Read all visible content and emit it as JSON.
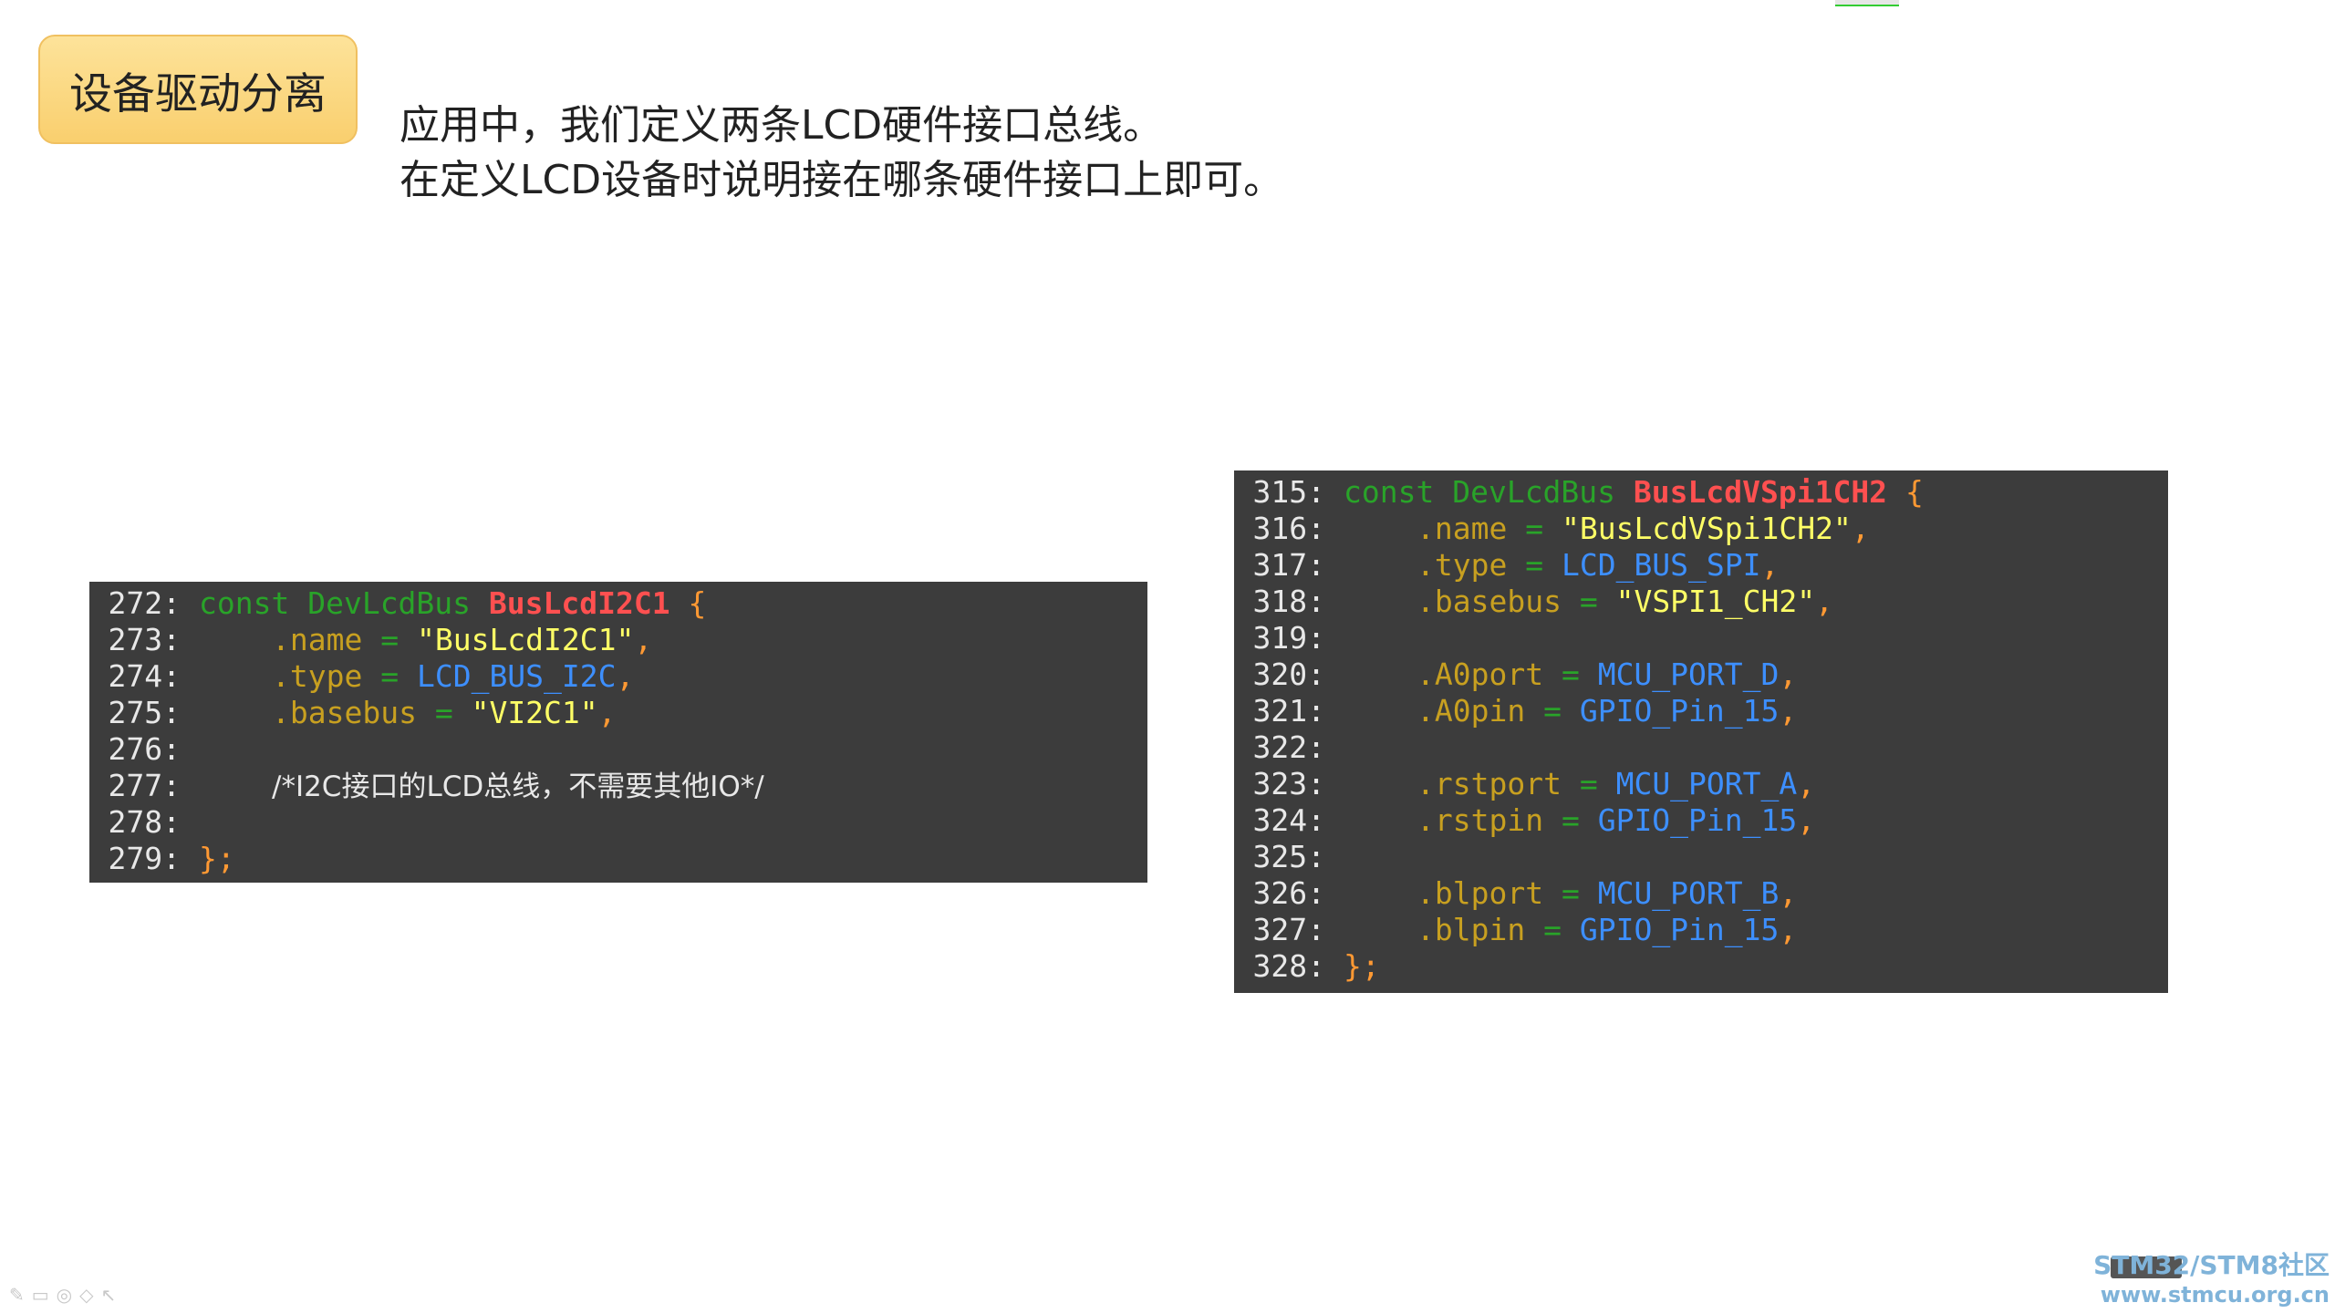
{
  "title": "设备驱动分离",
  "description": {
    "line1": "应用中，我们定义两条LCD硬件接口总线。",
    "line2": "在定义LCD设备时说明接在哪条硬件接口上即可。"
  },
  "code_left": {
    "lines": [
      {
        "num": "272:",
        "kw": "const",
        "type": "DevLcdBus",
        "name": "BusLcdI2C1",
        "brace": "{"
      },
      {
        "num": "273:",
        "prop": ".name",
        "eq": "=",
        "value": "\"BusLcdI2C1\"",
        "comma": ","
      },
      {
        "num": "274:",
        "prop": ".type",
        "eq": "=",
        "value": "LCD_BUS_I2C",
        "comma": ","
      },
      {
        "num": "275:",
        "prop": ".basebus",
        "eq": "=",
        "value": "\"VI2C1\"",
        "comma": ","
      },
      {
        "num": "276:"
      },
      {
        "num": "277:",
        "comment": "/*I2C接口的LCD总线，不需要其他IO*/"
      },
      {
        "num": "278:"
      },
      {
        "num": "279:",
        "close": "};"
      }
    ]
  },
  "code_right": {
    "lines": [
      {
        "num": "315:",
        "kw": "const",
        "type": "DevLcdBus",
        "name": "BusLcdVSpi1CH2",
        "brace": "{"
      },
      {
        "num": "316:",
        "prop": ".name",
        "eq": "=",
        "value": "\"BusLcdVSpi1CH2\"",
        "comma": ","
      },
      {
        "num": "317:",
        "prop": ".type",
        "eq": "=",
        "value": "LCD_BUS_SPI",
        "comma": ","
      },
      {
        "num": "318:",
        "prop": ".basebus",
        "eq": "=",
        "value": "\"VSPI1_CH2\"",
        "comma": ","
      },
      {
        "num": "319:"
      },
      {
        "num": "320:",
        "prop": ".A0port",
        "eq": "=",
        "value": "MCU_PORT_D",
        "comma": ","
      },
      {
        "num": "321:",
        "prop": ".A0pin",
        "eq": "=",
        "value": "GPIO_Pin_15",
        "comma": ","
      },
      {
        "num": "322:"
      },
      {
        "num": "323:",
        "prop": ".rstport",
        "eq": "=",
        "value": "MCU_PORT_A",
        "comma": ","
      },
      {
        "num": "324:",
        "prop": ".rstpin",
        "eq": "=",
        "value": "GPIO_Pin_15",
        "comma": ","
      },
      {
        "num": "325:"
      },
      {
        "num": "326:",
        "prop": ".blport",
        "eq": "=",
        "value": "MCU_PORT_B",
        "comma": ","
      },
      {
        "num": "327:",
        "prop": ".blpin",
        "eq": "=",
        "value": "GPIO_Pin_15",
        "comma": ","
      },
      {
        "num": "328:",
        "close": "};"
      }
    ]
  },
  "watermark": {
    "line1": "STM32/STM8社区",
    "line2": "www.stmcu.org.cn"
  },
  "toolbar_icons": [
    "pen-icon",
    "screen-icon",
    "eraser-icon",
    "marker-icon",
    "pointer-icon"
  ],
  "colors": {
    "code_bg": "#3c3c3c",
    "keyword": "#29a329",
    "name": "#ff5050",
    "string": "#ffff66",
    "constant": "#3d8fff",
    "punct": "#ff9933",
    "title_box": "#fbd77f"
  }
}
